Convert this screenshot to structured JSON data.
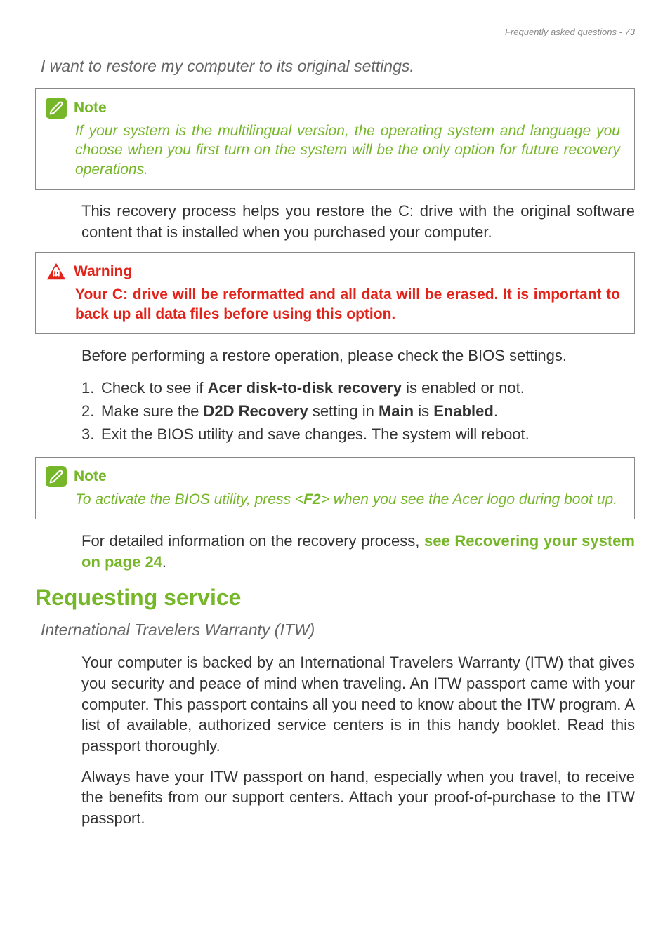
{
  "header": "Frequently asked questions - 73",
  "subheading1": "I want to restore my computer to its original settings.",
  "note1": {
    "title": "Note",
    "body": "If your system is the multilingual version, the operating system and language you choose when you first turn on the system will be the only option for future recovery operations."
  },
  "para1": "This recovery process helps you restore the C: drive with the original software content that is installed when you purchased your computer.",
  "warning1": {
    "title": "Warning",
    "body": "Your C: drive will be reformatted and all data will be erased. It is important to back up all data files before using this option."
  },
  "para2": "Before performing a restore operation, please check the BIOS settings.",
  "list1": {
    "item1_prefix": "Check to see if ",
    "item1_bold": "Acer disk-to-disk recovery",
    "item1_suffix": " is enabled or not.",
    "item2_prefix": "Make sure the ",
    "item2_bold1": "D2D Recovery",
    "item2_mid": " setting in ",
    "item2_bold2": "Main",
    "item2_mid2": " is ",
    "item2_bold3": "Enabled",
    "item2_suffix": ".",
    "item3": "Exit the BIOS utility and save changes. The system will reboot."
  },
  "note2": {
    "title": "Note",
    "body_prefix": "To activate the BIOS utility, press <",
    "body_key": "F2",
    "body_suffix": "> when you see the Acer logo during boot up."
  },
  "para3_prefix": "For detailed information on the recovery process, ",
  "para3_link": "see Recovering your system on page 24",
  "para3_suffix": ".",
  "section2": "Requesting service",
  "subheading2": "International Travelers Warranty (ITW)",
  "para4": "Your computer is backed by an International Travelers Warranty (ITW) that gives you security and peace of mind when traveling. An ITW passport came with your computer. This passport contains all you need to know about the ITW program. A list of available, authorized service centers is in this handy booklet. Read this passport thoroughly.",
  "para5": "Always have your ITW passport on hand, especially when you travel, to receive the benefits from our support centers. Attach your proof-of-purchase to the ITW passport."
}
